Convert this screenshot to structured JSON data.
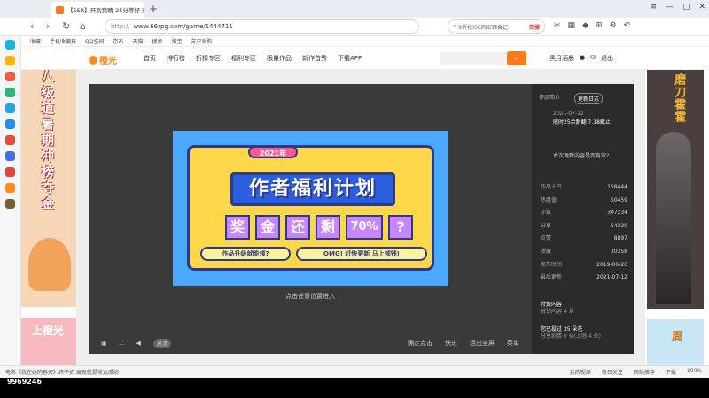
{
  "browser": {
    "tab_title": "【SSR】开到爽睛-25分等好 |",
    "url_protocol": "http://",
    "url": "www.66rpg.com/game/1444711",
    "search_text": "9折抢ISC网安臻会记",
    "search_hot": "热搜"
  },
  "favorites": [
    "收藏",
    "手机收藏夹",
    "QQ空间",
    "京东",
    "天猫",
    "搜索",
    "淘宝",
    "苏宁易购"
  ],
  "site": {
    "logo": "橙光",
    "nav": [
      "首页",
      "排行榜",
      "折扣专区",
      "福利专区",
      "限量作品",
      "新作首秀",
      "下载APP"
    ],
    "user_name": "黑月酒晨",
    "logout": "退出"
  },
  "banner_left": {
    "text": "八级道暑期冲榜夺金",
    "bottom_text": "上橙光"
  },
  "banner_right": {
    "text": "磨刀霍霍",
    "bottom_text": "周"
  },
  "poster": {
    "year": "2021年",
    "title": "作者福利计划",
    "chars": [
      "奖",
      "金",
      "还",
      "剩",
      "70%",
      "?"
    ],
    "btn1": "作品升级就能领?",
    "btn2": "OMG! 赶快更新 马上领钱!"
  },
  "game": {
    "click_enter": "点击任意位置进入",
    "clarity": "高清",
    "ctrl": [
      "确定点击",
      "快进",
      "退出全屏",
      "菜单"
    ]
  },
  "info": {
    "tab_intro": "作品简介",
    "tab_log": "更新日志",
    "upd_date": "2021-07-12",
    "upd_body": "限时25余耐翻 7.18截止",
    "upd_link": "本次更新内容是否有效?",
    "stats": [
      {
        "k": "作品人气",
        "v": "158444"
      },
      {
        "k": "热度值",
        "v": "50459"
      },
      {
        "k": "字数",
        "v": "307234"
      },
      {
        "k": "分享",
        "v": "54320"
      },
      {
        "k": "点赞",
        "v": "8897"
      },
      {
        "k": "收藏",
        "v": "30358"
      },
      {
        "k": "发布时间",
        "v": "2019-06-26"
      },
      {
        "k": "最后更新",
        "v": "2021-07-12"
      }
    ],
    "ex1_title": "付费内容",
    "ex1_sub": "解锁内容 4 朵",
    "ex2_title": "您已投过 35 朵花",
    "ex2_sub": "分享剧情 0 朵(上限 4 朵)"
  },
  "status": {
    "left": "电影《我在她的春天》终于拍 展现就是攻克成绩",
    "items": [
      "我的视频",
      "每日关注",
      "网站推荐",
      "下载",
      "100%"
    ]
  },
  "overlay_number": "9969246"
}
